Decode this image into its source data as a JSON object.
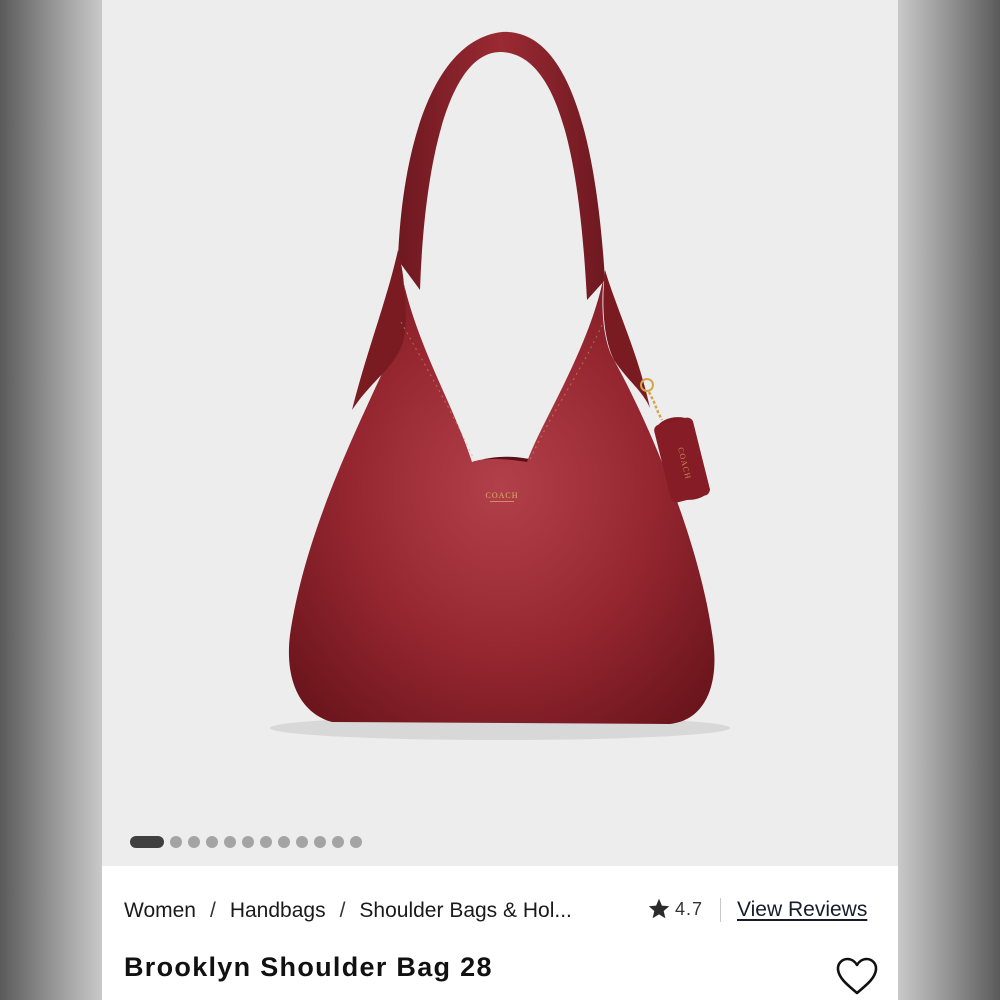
{
  "gallery": {
    "image_description_icon": "red-leather-shoulder-bag",
    "brand_stamp": "COACH",
    "hangtag_text": "COACH",
    "total_slides": 12,
    "active_slide": 1
  },
  "breadcrumb": {
    "items": [
      "Women",
      "Handbags",
      "Shoulder Bags & Hol..."
    ],
    "separator": "/"
  },
  "rating": {
    "value": "4.7",
    "icon": "star-icon"
  },
  "reviews_link": "View Reviews",
  "product": {
    "title": "Brooklyn Shoulder Bag 28",
    "wishlist_icon": "heart-icon"
  },
  "colors": {
    "bag": "#8e1f27",
    "background": "#ededed",
    "dot_active": "#3f3f3f",
    "dot_inactive": "#a4a4a4"
  }
}
